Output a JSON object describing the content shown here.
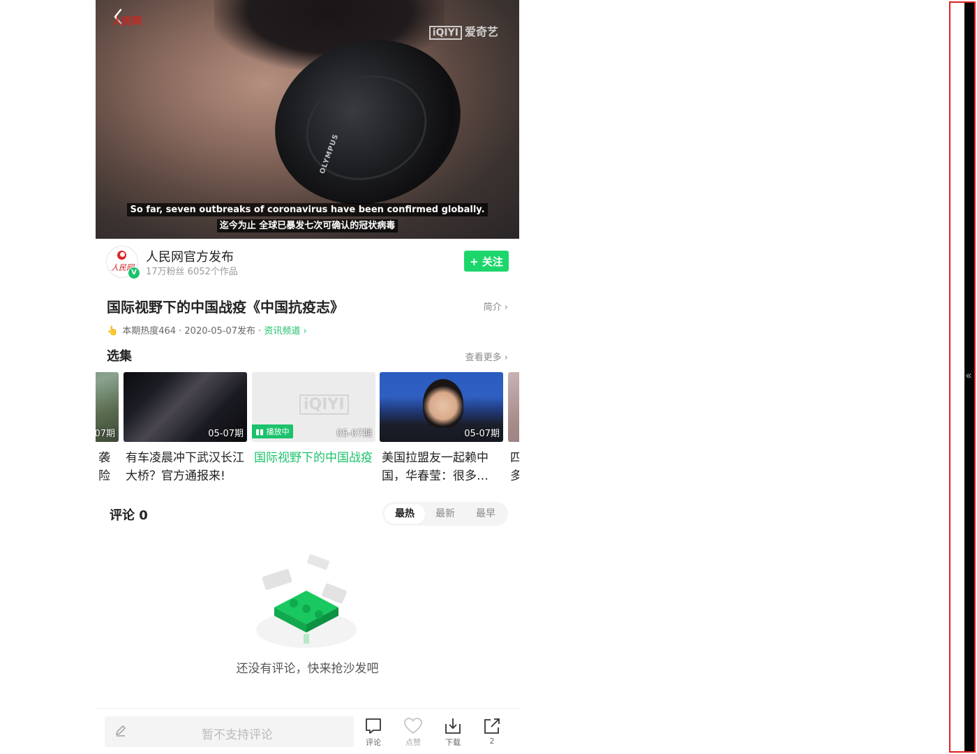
{
  "video": {
    "logo_left": "人民网",
    "logo_right_box": "iQIYI",
    "logo_right_text": "爱奇艺",
    "lens_brand": "OLYMPUS",
    "subtitle_en": "So far, seven outbreaks of coronavirus have been confirmed globally.",
    "subtitle_zh": "迄今为止 全球已暴发七次可确认的冠状病毒"
  },
  "author": {
    "avatar_text": "人民网",
    "name": "人民网官方发布",
    "meta": "17万粉丝 6052个作品",
    "follow_label": "+ 关注",
    "verified": "V"
  },
  "video_info": {
    "title": "国际视野下的中国战疫《中国抗疫志》",
    "intro_link": "简介 ›",
    "heat": "本期热度464",
    "published": " · 2020-05-07发布 · ",
    "channel": "资讯频道 ›"
  },
  "episodes": {
    "section_title": "选集",
    "more_link": "查看更多 ›",
    "items": [
      {
        "date": "07期",
        "title": "袭\n险"
      },
      {
        "date": "05-07期",
        "title": "有车凌晨冲下武汉长江大桥？官方通报来!"
      },
      {
        "date": "05-07期",
        "title": "国际视野下的中国战疫",
        "playing": "播放中"
      },
      {
        "date": "05-07期",
        "title": "美国拉盟友一起赖中国，华春莹：很多…"
      },
      {
        "date": "",
        "title": "四\n多"
      }
    ]
  },
  "comments": {
    "title": "评论 0",
    "tabs": [
      "最热",
      "最新",
      "最早"
    ],
    "active_tab": "最热",
    "empty_text": "还没有评论，快来抢沙发吧"
  },
  "bottom_bar": {
    "placeholder": "暂不支持评论",
    "actions": [
      {
        "icon": "comment-icon",
        "label": "评论"
      },
      {
        "icon": "heart-icon",
        "label": "点赞"
      },
      {
        "icon": "download-icon",
        "label": "下载"
      },
      {
        "icon": "share-icon",
        "label": "2"
      }
    ]
  },
  "colors": {
    "accent_green": "#1cc26b",
    "follow_green": "#1cd66c",
    "strip_border": "#e02020"
  },
  "side": {
    "collapse_glyph": "«"
  }
}
